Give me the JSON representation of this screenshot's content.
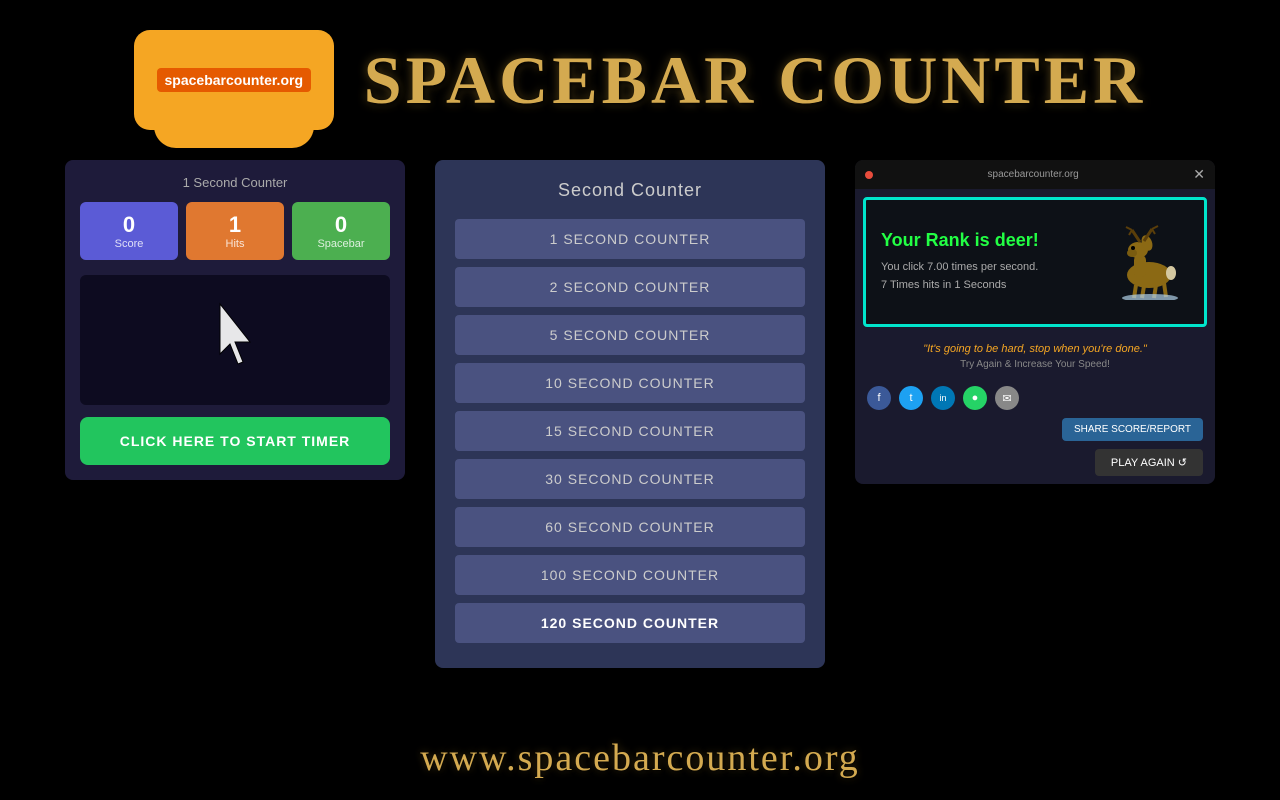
{
  "header": {
    "logo_text": "spacebarcounter.org",
    "site_title": "SPACEBAR COUNTER"
  },
  "footer": {
    "url": "www.spacebarcounter.org"
  },
  "left_panel": {
    "title": "1 Second Counter",
    "score_boxes": [
      {
        "label": "Score",
        "value": "0",
        "color": "blue"
      },
      {
        "label": "Hits",
        "value": "1",
        "color": "orange"
      },
      {
        "label": "Spacebar",
        "value": "0",
        "color": "green"
      }
    ],
    "click_button": "CLICK HERE TO START TIMER"
  },
  "center_panel": {
    "title": "Second Counter",
    "items": [
      {
        "label": "1 SECOND COUNTER"
      },
      {
        "label": "2 SECOND COUNTER"
      },
      {
        "label": "5 SECOND COUNTER"
      },
      {
        "label": "10 SECOND COUNTER"
      },
      {
        "label": "15 SECOND COUNTER"
      },
      {
        "label": "30 SECOND COUNTER"
      },
      {
        "label": "60 SECOND COUNTER"
      },
      {
        "label": "100 SECOND COUNTER"
      },
      {
        "label": "120 SECOND COUNTER"
      }
    ]
  },
  "right_panel": {
    "header_url": "spacebarcounter.org",
    "rank_title": "Your Rank is deer!",
    "rank_line1": "You click 7.00 times per second.",
    "rank_line2": "7 Times hits in 1 Seconds",
    "quote": "\"It's going to be hard, stop when you're done.\"",
    "try_again_text": "Try Again & Increase Your Speed!",
    "share_score_btn": "SHARE SCORE/REPORT",
    "play_again_btn": "PLAY AGAIN ↺",
    "social_icons": [
      {
        "label": "f",
        "class": "si-fb"
      },
      {
        "label": "t",
        "class": "si-tw"
      },
      {
        "label": "in",
        "class": "si-ln"
      },
      {
        "label": "●",
        "class": "si-wh"
      },
      {
        "label": "✉",
        "class": "si-em"
      }
    ]
  }
}
